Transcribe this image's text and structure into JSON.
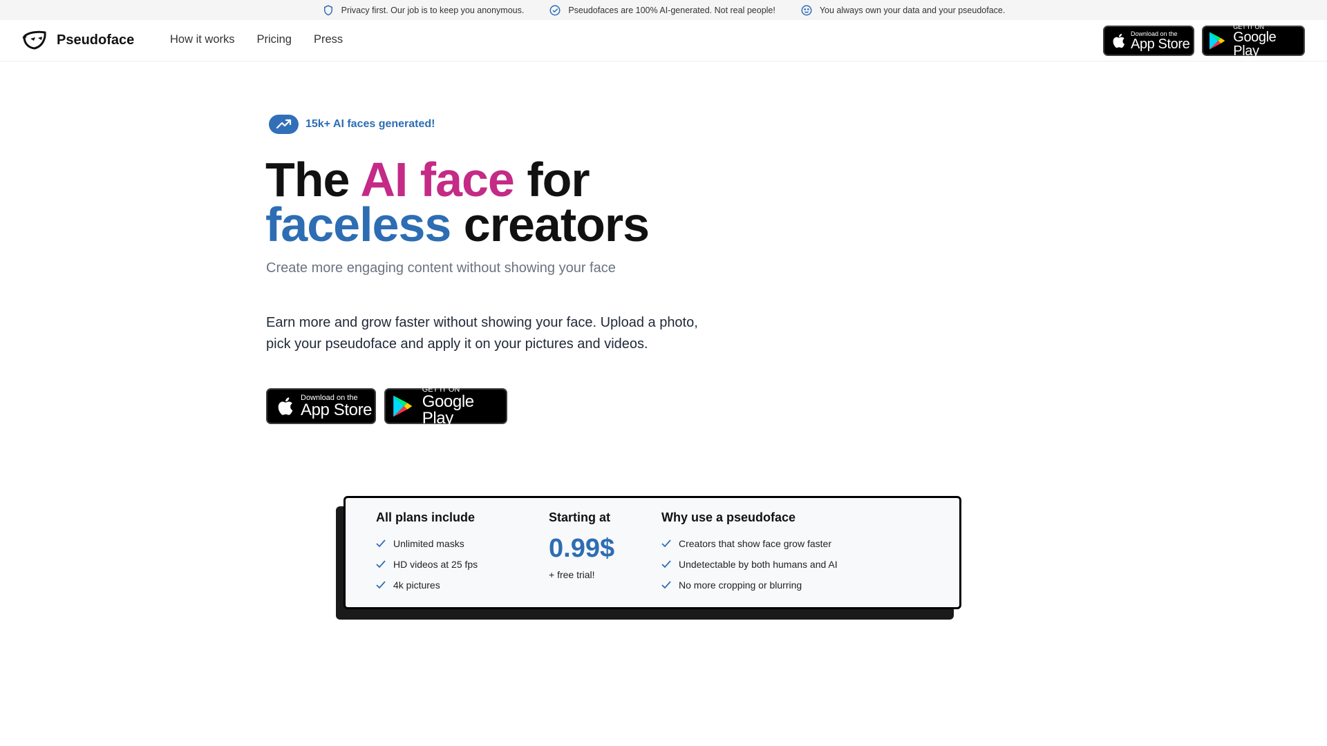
{
  "topbar": {
    "messages": [
      {
        "icon": "shield-icon",
        "text": "Privacy first. Our job is to keep you anonymous."
      },
      {
        "icon": "check-badge-icon",
        "text": "Pseudofaces are 100% AI-generated. Not real people!"
      },
      {
        "icon": "smiley-icon",
        "text": "You always own your data and your pseudoface."
      }
    ]
  },
  "nav": {
    "brand": "Pseudoface",
    "links": [
      "How it works",
      "Pricing",
      "Press"
    ],
    "appstore": {
      "small": "Download on the",
      "big": "App Store"
    },
    "googleplay": {
      "small": "GET IT ON",
      "big": "Google Play"
    }
  },
  "hero": {
    "badge": "15k+ AI faces generated!",
    "headline": {
      "part1": "The ",
      "part2": "AI face",
      "part3": " for",
      "part4": "faceless",
      "part5": " creators"
    },
    "subtitle": "Create more engaging content without showing your face",
    "body_line1": "Earn more and grow faster without showing your face. Upload a photo,",
    "body_line2": "pick your pseudoface and apply it on your pictures and videos.",
    "appstore": {
      "small": "Download on the",
      "big": "App Store"
    },
    "googleplay": {
      "small": "GET IT ON",
      "big": "Google Play"
    }
  },
  "plans": {
    "col1_title": "All plans include",
    "col1_items": [
      "Unlimited masks",
      "HD videos at 25 fps",
      "4k pictures"
    ],
    "col2_title": "Starting at",
    "price": "0.99$",
    "trial": "+ free trial!",
    "col3_title": "Why use a pseudoface",
    "col3_items": [
      "Creators that show face grow faster",
      "Undetectable by both humans and AI",
      "No more cropping or blurring"
    ]
  },
  "colors": {
    "accent_blue": "#2d6db3",
    "accent_pink": "#c42a86"
  }
}
